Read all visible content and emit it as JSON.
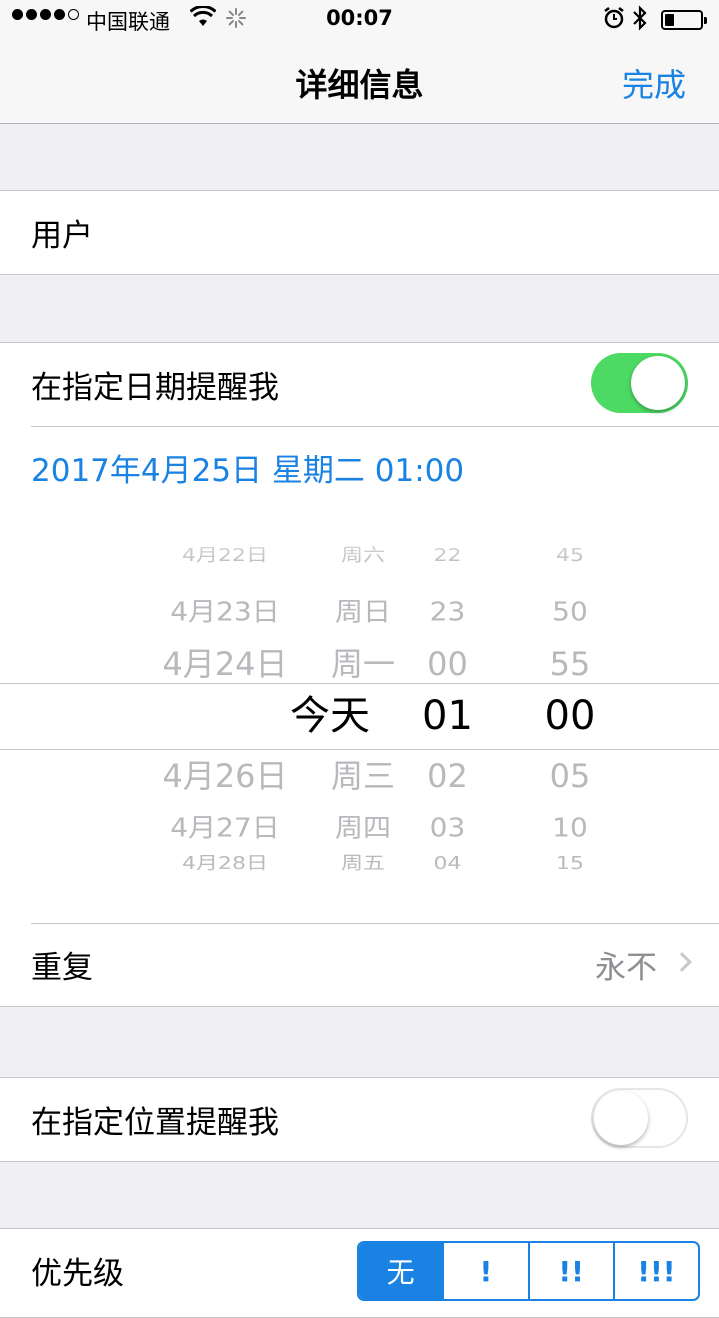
{
  "status_bar": {
    "carrier": "中国联通",
    "time": "00:07",
    "icons": [
      "signal-dots-icon",
      "wifi-icon",
      "activity-spinner-icon",
      "alarm-icon",
      "bluetooth-icon",
      "battery-icon"
    ]
  },
  "nav": {
    "title": "详细信息",
    "done_label": "完成"
  },
  "user_row": {
    "label": "用户"
  },
  "date_reminder": {
    "label": "在指定日期提醒我",
    "toggle_on": true,
    "date_text": "2017年4月25日 星期二 01:00"
  },
  "picker": {
    "dates": [
      {
        "date": "4月22日",
        "day": "周六"
      },
      {
        "date": "4月23日",
        "day": "周日"
      },
      {
        "date": "4月24日",
        "day": "周一"
      },
      {
        "date": "今天",
        "day": ""
      },
      {
        "date": "4月26日",
        "day": "周三"
      },
      {
        "date": "4月27日",
        "day": "周四"
      },
      {
        "date": "4月28日",
        "day": "周五"
      }
    ],
    "hours": [
      "22",
      "23",
      "00",
      "01",
      "02",
      "03",
      "04"
    ],
    "minutes": [
      "45",
      "50",
      "55",
      "00",
      "05",
      "10",
      "15"
    ],
    "selected_index": 3
  },
  "repeat": {
    "label": "重复",
    "value": "永不"
  },
  "location_reminder": {
    "label": "在指定位置提醒我",
    "toggle_on": false
  },
  "priority": {
    "label": "优先级",
    "options": [
      "无",
      "!",
      "!!",
      "!!!"
    ],
    "selected_index": 0
  },
  "colors": {
    "accent": "#1a82e2",
    "toggle_on": "#4cd964",
    "background": "#efeff4"
  }
}
